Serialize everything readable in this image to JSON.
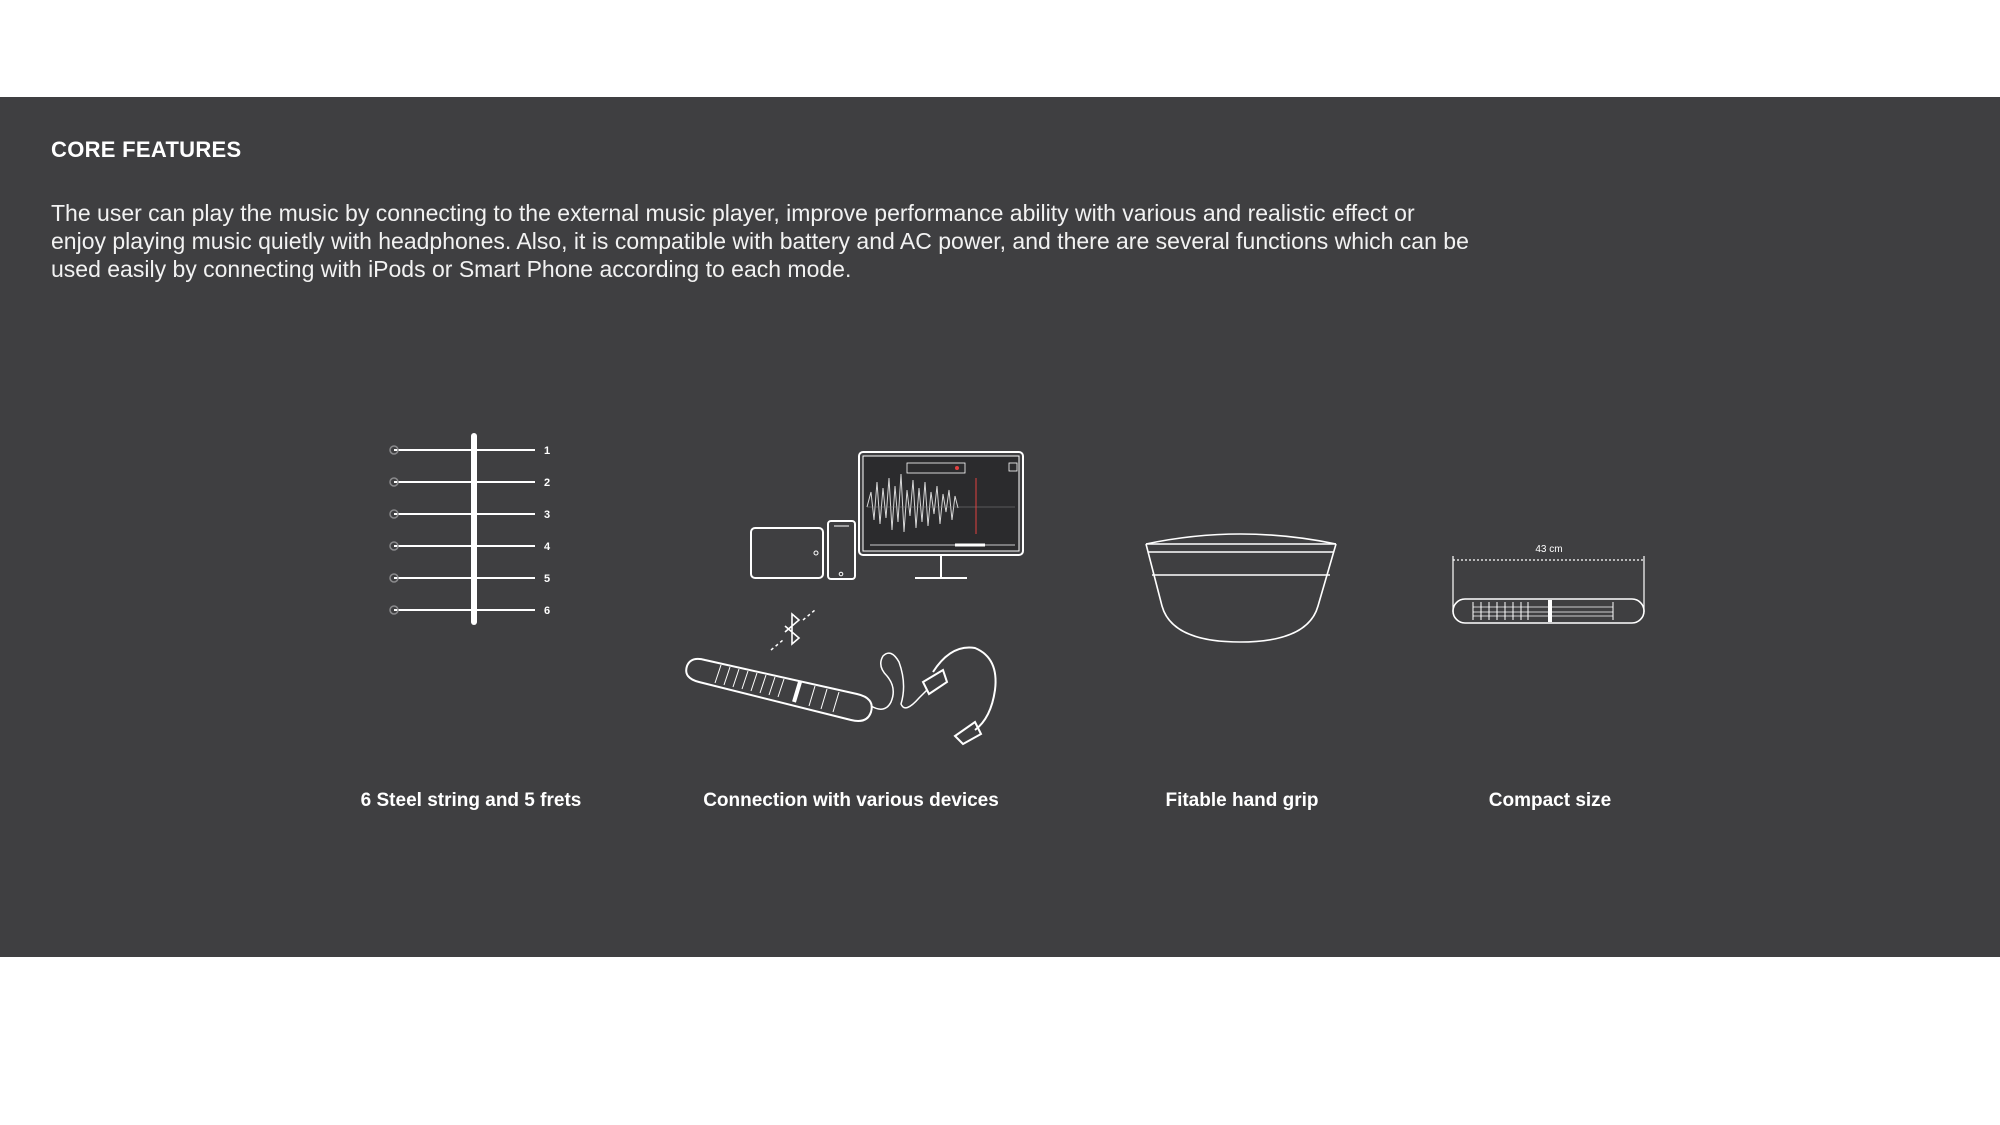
{
  "section": {
    "title": "CORE FEATURES",
    "description": "The user can play the music by connecting to the external music player, improve performance ability with various and realistic effect or enjoy playing music quietly with headphones. Also, it is compatible with battery and AC power, and there are several functions which can be used easily by connecting with iPods or Smart Phone according to each mode."
  },
  "features": [
    {
      "caption": "6 Steel string and 5 frets",
      "icon": "strings-frets-icon",
      "string_numbers": [
        "1",
        "2",
        "3",
        "4",
        "5",
        "6"
      ]
    },
    {
      "caption": "Connection  with various devices",
      "icon": "device-connection-icon"
    },
    {
      "caption": "Fitable hand grip",
      "icon": "hand-grip-icon"
    },
    {
      "caption": "Compact size",
      "icon": "compact-size-icon",
      "dimension_label": "43 cm"
    }
  ],
  "colors": {
    "panel_bg": "#3f3f41",
    "line": "#ffffff",
    "text": "#ffffff"
  }
}
